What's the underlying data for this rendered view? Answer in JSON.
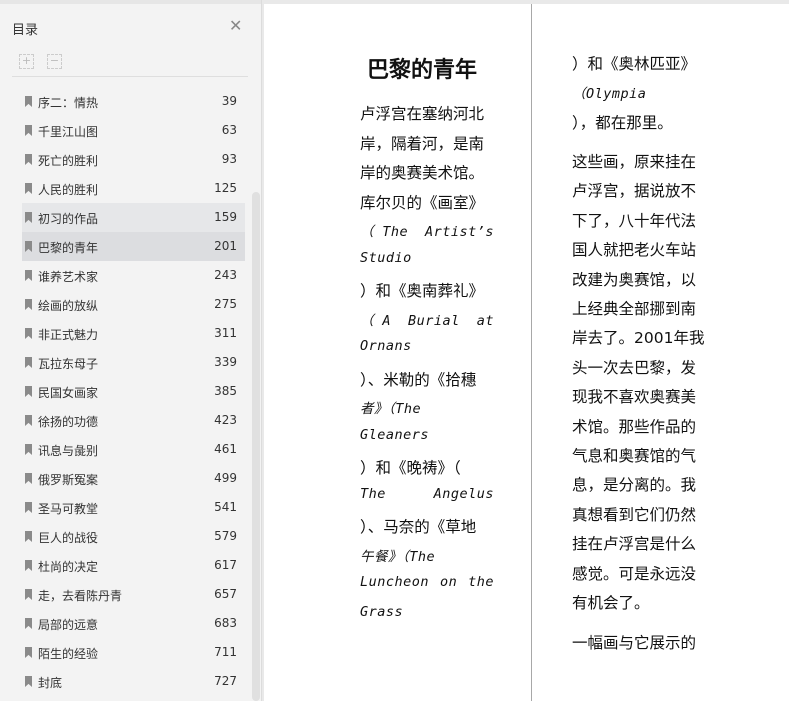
{
  "sidebar": {
    "title": "目录",
    "close_icon": "close-icon",
    "expand_icon": "expand-all-icon",
    "collapse_icon": "collapse-all-icon",
    "items": [
      {
        "label": "序二：情热",
        "page": "39"
      },
      {
        "label": "千里江山图",
        "page": "63"
      },
      {
        "label": "死亡的胜利",
        "page": "93"
      },
      {
        "label": "人民的胜利",
        "page": "125"
      },
      {
        "label": "初习的作品",
        "page": "159"
      },
      {
        "label": "巴黎的青年",
        "page": "201"
      },
      {
        "label": "谁养艺术家",
        "page": "243"
      },
      {
        "label": "绘画的放纵",
        "page": "275"
      },
      {
        "label": "非正式魅力",
        "page": "311"
      },
      {
        "label": "瓦拉东母子",
        "page": "339"
      },
      {
        "label": "民国女画家",
        "page": "385"
      },
      {
        "label": "徐扬的功德",
        "page": "423"
      },
      {
        "label": "讯息与彘别",
        "page": "461"
      },
      {
        "label": "俄罗斯冤案",
        "page": "499"
      },
      {
        "label": "圣马可教堂",
        "page": "541"
      },
      {
        "label": "巨人的战役",
        "page": "579"
      },
      {
        "label": "杜尚的决定",
        "page": "617"
      },
      {
        "label": "走，去看陈丹青",
        "page": "657"
      },
      {
        "label": "局部的远意",
        "page": "683"
      },
      {
        "label": "陌生的经验",
        "page": "711"
      },
      {
        "label": "封底",
        "page": "727"
      }
    ]
  },
  "page": {
    "title": "巴黎的青年",
    "left_lines": [
      {
        "t": "卢浮宫在塞纳河北"
      },
      {
        "t": "岸，隔着河，是南"
      },
      {
        "t": "岸的奥赛美术馆。"
      },
      {
        "t": "库尔贝的《画室》"
      },
      {
        "t": "（The  Artist’s",
        "i": 1
      },
      {
        "t": "Studio",
        "i": 1
      },
      {
        "t": "）和《奥南葬礼》"
      },
      {
        "t": "（A  Burial   at",
        "i": 1
      },
      {
        "t": "Ornans",
        "i": 1
      },
      {
        "t": "）、米勒的《拾穗"
      },
      {
        "t": "者》（The",
        "i": 1
      },
      {
        "t": "Gleaners",
        "i": 1
      },
      {
        "t": "）和《晚祷》（"
      },
      {
        "t": "The      Angelus",
        "i": 1
      },
      {
        "t": "）、马奈的《草地"
      },
      {
        "t": "午餐》（The",
        "i": 1
      },
      {
        "t": "Luncheon  on  the",
        "i": 1
      },
      {
        "t": "Grass",
        "i": 1
      }
    ],
    "right_lines": [
      {
        "t": "）和《奥林匹亚》"
      },
      {
        "t": "（Olympia",
        "i": 1
      },
      {
        "t": "），都在那里。"
      },
      {
        "t": "这些画，原来挂在"
      },
      {
        "t": "卢浮宫，据说放不"
      },
      {
        "t": "下了，八十年代法"
      },
      {
        "t": "国人就把老火车站"
      },
      {
        "t": "改建为奥赛馆，以"
      },
      {
        "t": "上经典全部挪到南"
      },
      {
        "t": "岸去了。2001年我"
      },
      {
        "t": "头一次去巴黎，发"
      },
      {
        "t": "现我不喜欢奥赛美"
      },
      {
        "t": "术馆。那些作品的"
      },
      {
        "t": "气息和奥赛馆的气"
      },
      {
        "t": "息，是分离的。我"
      },
      {
        "t": "真想看到它们仍然"
      },
      {
        "t": "挂在卢浮宫是什么"
      },
      {
        "t": "感觉。可是永远没"
      },
      {
        "t": "有机会了。"
      },
      {
        "t": "一幅画与它展示的"
      }
    ]
  }
}
